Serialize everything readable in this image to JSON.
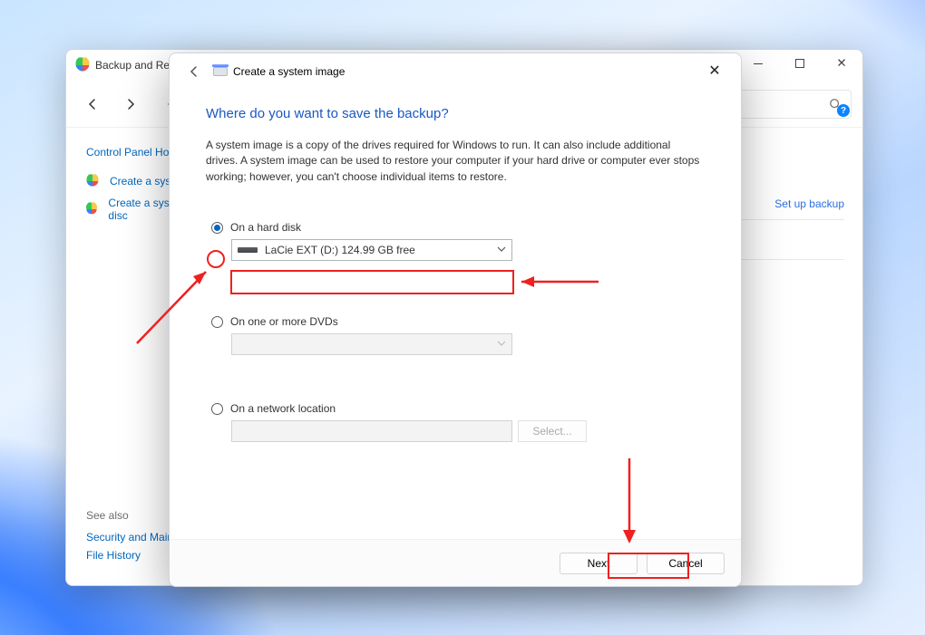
{
  "parent": {
    "title": "Backup and Restore",
    "home": "Control Panel Home",
    "link_image": "Create a system image",
    "link_repair": "Create a system repair disc",
    "set_up": "Set up backup",
    "see_also_label": "See also",
    "see_also_security": "Security and Maintenance",
    "see_also_history": "File History"
  },
  "dialog": {
    "title": "Create a system image",
    "heading": "Where do you want to save the backup?",
    "description": "A system image is a copy of the drives required for Windows to run. It can also include additional drives. A system image can be used to restore your computer if your hard drive or computer ever stops working; however, you can't choose individual items to restore.",
    "opt_disk": "On a hard disk",
    "selected_disk": "LaCie EXT (D:)  124.99 GB free",
    "opt_dvd": "On one or more DVDs",
    "opt_net": "On a network location",
    "select_btn": "Select...",
    "next": "Next",
    "cancel": "Cancel"
  }
}
